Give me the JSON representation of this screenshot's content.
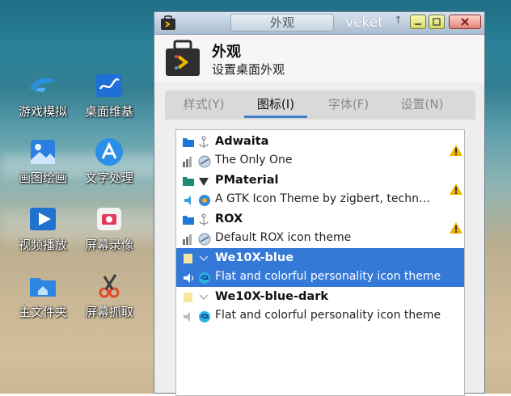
{
  "desktop": {
    "icons": [
      {
        "label": "游戏模拟",
        "icon": "dolphin-icon"
      },
      {
        "label": "桌面维基",
        "icon": "wiki-icon"
      },
      {
        "label": "画图绘画",
        "icon": "paint-icon"
      },
      {
        "label": "文字处理",
        "icon": "writer-icon"
      },
      {
        "label": "视频播放",
        "icon": "video-player-icon"
      },
      {
        "label": "屏幕录像",
        "icon": "screen-recorder-icon"
      },
      {
        "label": "主文件夹",
        "icon": "home-folder-icon"
      },
      {
        "label": "屏幕抓取",
        "icon": "screenshot-icon"
      }
    ]
  },
  "window": {
    "title": "外观",
    "user": "veket",
    "pin_symbol": "↑",
    "header": {
      "title": "外观",
      "subtitle": "设置桌面外观"
    },
    "tabs": [
      {
        "label": "样式(Y)",
        "active": false
      },
      {
        "label": "图标(I)",
        "active": true
      },
      {
        "label": "字体(F)",
        "active": false
      },
      {
        "label": "设置(N)",
        "active": false
      }
    ],
    "themes": [
      {
        "name": "Adwaita",
        "description": "The Only One",
        "warning": true,
        "selected": false
      },
      {
        "name": "PMaterial",
        "description": "A GTK Icon Theme by zigbert, techn…",
        "warning": true,
        "selected": false
      },
      {
        "name": "ROX",
        "description": "Default ROX icon theme",
        "warning": true,
        "selected": false
      },
      {
        "name": "We10X-blue",
        "description": "Flat and colorful personality icon theme",
        "warning": false,
        "selected": true
      },
      {
        "name": "We10X-blue-dark",
        "description": "Flat and colorful personality icon theme",
        "warning": false,
        "selected": false
      }
    ]
  },
  "colors": {
    "selection": "#3478d8",
    "tab_underline": "#3a80c8",
    "warning": "#f0b400"
  }
}
